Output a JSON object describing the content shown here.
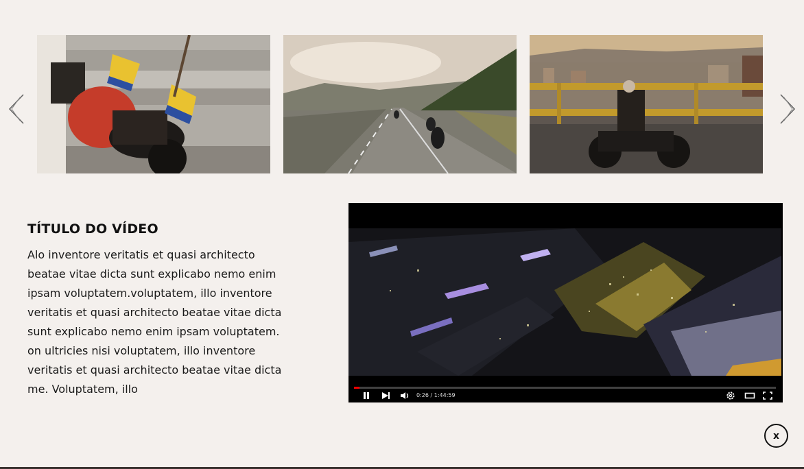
{
  "gallery": {
    "prev_icon": "chevron-left-icon",
    "next_icon": "chevron-right-icon",
    "thumbnails": [
      {
        "subject": "motorcycle with flags parked by steps"
      },
      {
        "subject": "bikers riding on a mountain road"
      },
      {
        "subject": "biker on a bridge overlooking the city"
      }
    ]
  },
  "video": {
    "title": "TÍTULO DO VÍDEO",
    "description": "Alo inventore veritatis et quasi architecto beatae vitae dicta sunt explicabo nemo enim ipsam voluptatem.voluptatem, illo inventore veritatis et quasi architecto beatae vitae dicta sunt explicabo nemo enim ipsam voluptatem. on ultricies nisi voluptatem, illo inventore veritatis et quasi architecto beatae vitae dicta me. Voluptatem, illo"
  },
  "player": {
    "time": "0:26 / 1:44:59",
    "progress": 0.004,
    "controls": [
      "pause-icon",
      "next-icon",
      "volume-icon",
      "settings-icon",
      "theater-icon",
      "fullscreen-icon"
    ]
  },
  "close": {
    "label": "x"
  },
  "colors": {
    "background": "#f4f0ed",
    "text": "#111111",
    "player_bg": "#000000",
    "progress": "#ee0000"
  }
}
